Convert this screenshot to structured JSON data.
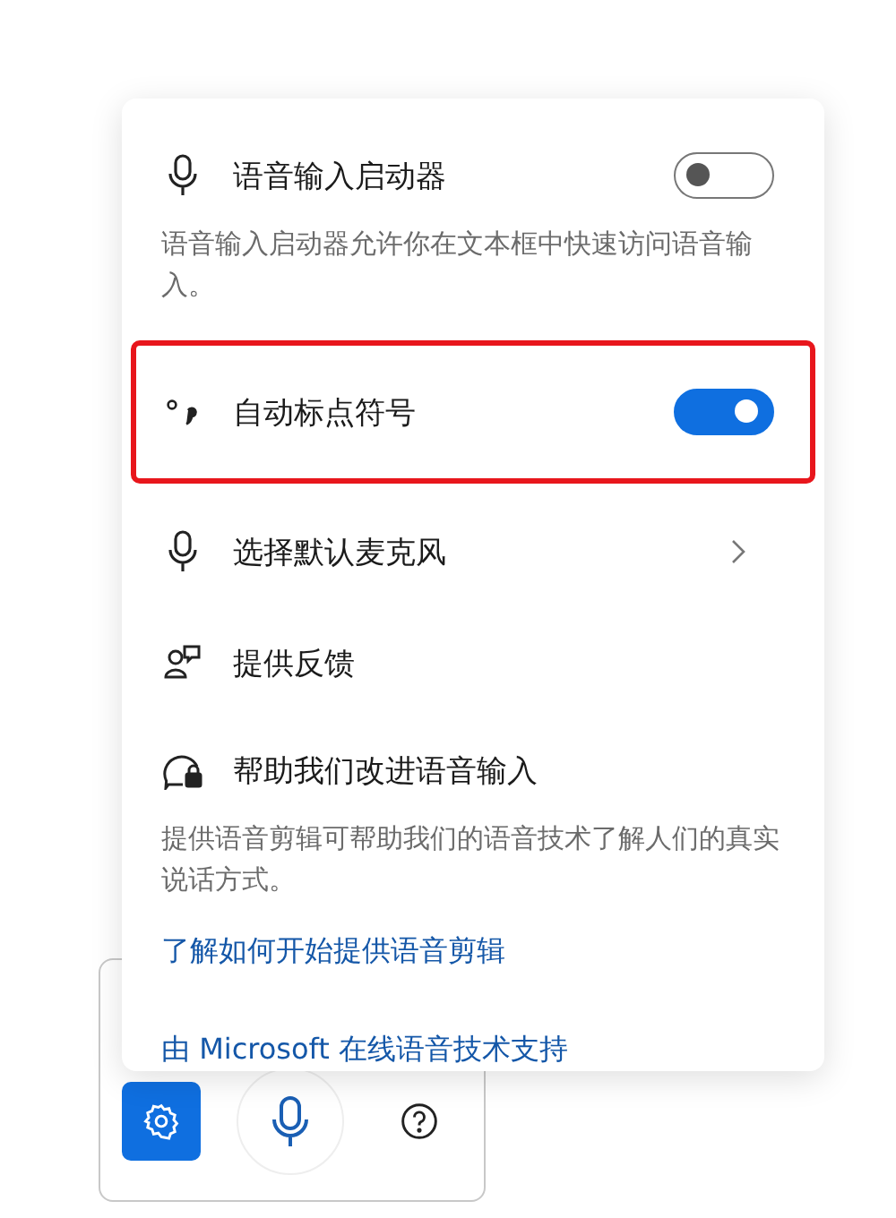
{
  "menu": {
    "items": [
      {
        "kind": "toggle",
        "label": "语音输入启动器",
        "on": false,
        "highlighted": false,
        "description": "语音输入启动器允许你在文本框中快速访问语音输入。"
      },
      {
        "kind": "toggle",
        "label": "自动标点符号",
        "on": true,
        "highlighted": true
      },
      {
        "kind": "nav",
        "label": "选择默认麦克风"
      },
      {
        "kind": "action",
        "label": "提供反馈"
      },
      {
        "kind": "info",
        "label": "帮助我们改进语音输入",
        "description": "提供语音剪辑可帮助我们的语音技术了解人们的真实说话方式。",
        "link": "了解如何开始提供语音剪辑"
      }
    ],
    "footer_link": "由 Microsoft 在线语音技术支持"
  },
  "toolbar": {
    "buttons": [
      {
        "kind": "settings",
        "selected": true
      },
      {
        "kind": "voice",
        "selected": false
      },
      {
        "kind": "help",
        "selected": false
      }
    ]
  }
}
